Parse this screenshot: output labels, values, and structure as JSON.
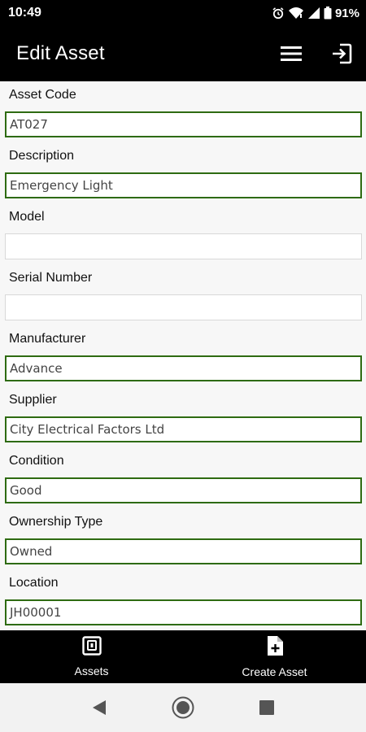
{
  "status_bar": {
    "time": "10:49",
    "battery": "91%",
    "icons": [
      "alarm-icon",
      "wifi-icon",
      "signal-icon",
      "battery-icon"
    ]
  },
  "app_bar": {
    "title": "Edit Asset",
    "actions": [
      "menu-icon",
      "logout-icon"
    ]
  },
  "form": {
    "fields": [
      {
        "label": "Asset Code",
        "value": "AT027"
      },
      {
        "label": "Description",
        "value": "Emergency Light"
      },
      {
        "label": "Model",
        "value": ""
      },
      {
        "label": "Serial Number",
        "value": ""
      },
      {
        "label": "Manufacturer",
        "value": "Advance"
      },
      {
        "label": "Supplier",
        "value": "City Electrical Factors Ltd"
      },
      {
        "label": "Condition",
        "value": "Good"
      },
      {
        "label": "Ownership Type",
        "value": "Owned"
      },
      {
        "label": "Location",
        "value": "JH00001"
      }
    ]
  },
  "bottom_nav": {
    "items": [
      {
        "label": "Assets",
        "icon": "assets-icon"
      },
      {
        "label": "Create Asset",
        "icon": "create-asset-icon"
      }
    ]
  },
  "system_nav": {
    "buttons": [
      "back-icon",
      "home-icon",
      "recents-icon"
    ]
  },
  "colors": {
    "bar_background": "#000000",
    "field_border": "#2e6b12",
    "form_background": "#f7f7f7"
  }
}
